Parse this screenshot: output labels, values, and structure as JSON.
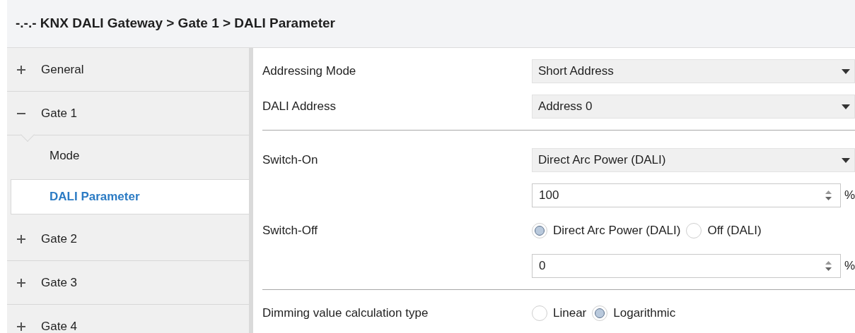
{
  "breadcrumb": "-.-.- KNX DALI Gateway > Gate 1 > DALI Parameter",
  "sidebar": {
    "items": [
      {
        "kind": "group",
        "label": "General",
        "expanded": false
      },
      {
        "kind": "group",
        "label": "Gate 1",
        "expanded": true
      },
      {
        "kind": "child",
        "label": "Mode",
        "selected": false
      },
      {
        "kind": "child",
        "label": "DALI Parameter",
        "selected": true
      },
      {
        "kind": "group",
        "label": "Gate 2",
        "expanded": false
      },
      {
        "kind": "group",
        "label": "Gate 3",
        "expanded": false
      },
      {
        "kind": "group",
        "label": "Gate 4",
        "expanded": false
      }
    ]
  },
  "sections": [
    {
      "rows": [
        {
          "kind": "dropdown",
          "label": "Addressing Mode",
          "value": "Short Address"
        },
        {
          "kind": "dropdown",
          "label": "DALI Address",
          "value": "Address 0"
        }
      ]
    },
    {
      "rows": [
        {
          "kind": "dropdown",
          "label": "Switch-On",
          "value": "Direct Arc Power (DALI)"
        },
        {
          "kind": "spin",
          "value": "100",
          "unit": "%"
        },
        {
          "kind": "radio",
          "label": "Switch-Off",
          "options": [
            {
              "label": "Direct Arc Power (DALI)",
              "selected": true
            },
            {
              "label": "Off (DALI)",
              "selected": false
            }
          ]
        },
        {
          "kind": "spin",
          "value": "0",
          "unit": "%"
        }
      ]
    },
    {
      "rows": [
        {
          "kind": "radio",
          "label": "Dimming value calculation type",
          "options": [
            {
              "label": "Linear",
              "selected": false
            },
            {
              "label": "Logarithmic",
              "selected": true
            }
          ]
        }
      ]
    }
  ]
}
